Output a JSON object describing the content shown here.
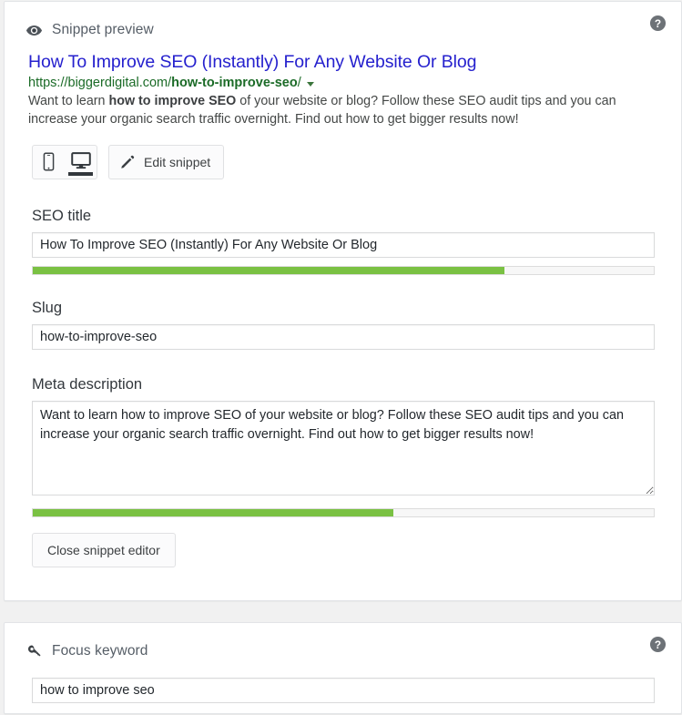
{
  "page": {
    "background": "#f1f1f1"
  },
  "snippet_card": {
    "header": {
      "icon": "eye-icon",
      "title": "Snippet preview",
      "help_icon": "help-circle-icon"
    },
    "preview": {
      "title": "How To Improve SEO (Instantly) For Any Website Or Blog",
      "url_base": "https://biggerdigital.com/",
      "url_slug": "how-to-improve-seo",
      "url_trailing": "/",
      "caret_icon": "chevron-down-icon",
      "description_part1": "Want to learn ",
      "description_bold": "how to improve SEO",
      "description_part2": " of your website or blog? Follow these SEO audit tips and you can increase your organic search traffic overnight. Find out how to get bigger results now!"
    },
    "controls": {
      "mobile_icon": "mobile-phone-icon",
      "desktop_icon": "desktop-monitor-icon",
      "active_device": "desktop",
      "edit_icon": "pencil-icon",
      "edit_label": "Edit snippet",
      "close_label": "Close snippet editor"
    },
    "fields": {
      "seo_title": {
        "label": "SEO title",
        "value": "How To Improve SEO (Instantly) For Any Website Or Blog",
        "progress_percent": 76,
        "progress_color": "#7ac143"
      },
      "slug": {
        "label": "Slug",
        "value": "how-to-improve-seo"
      },
      "meta_description": {
        "label": "Meta description",
        "value": "Want to learn how to improve SEO of your website or blog? Follow these SEO audit tips and you can increase your organic search traffic overnight. Find out how to get bigger results now!",
        "progress_percent": 58,
        "progress_color": "#7ac143"
      }
    }
  },
  "focus_card": {
    "header": {
      "icon": "key-icon",
      "title": "Focus keyword",
      "help_icon": "help-circle-icon"
    },
    "input": {
      "value": "how to improve seo"
    }
  }
}
